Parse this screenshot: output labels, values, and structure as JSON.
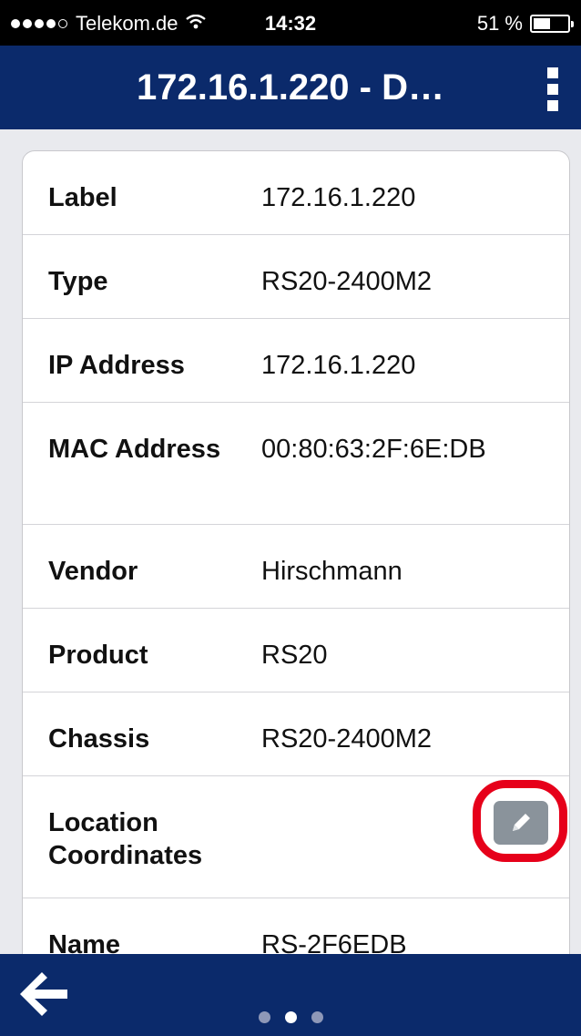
{
  "status_bar": {
    "carrier": "Telekom.de",
    "time": "14:32",
    "battery": "51 %",
    "battery_level": 0.51,
    "signal_bars": 4
  },
  "header": {
    "title": "172.16.1.220 - D…"
  },
  "details": [
    {
      "label": "Label",
      "value": "172.16.1.220"
    },
    {
      "label": "Type",
      "value": "RS20-2400M2"
    },
    {
      "label": "IP Address",
      "value": "172.16.1.220"
    },
    {
      "label": "MAC Address",
      "value": "00:80:63:2F:6E:DB"
    },
    {
      "label": "Vendor",
      "value": "Hirschmann"
    },
    {
      "label": "Product",
      "value": "RS20"
    },
    {
      "label": "Chassis",
      "value": "RS20-2400M2"
    },
    {
      "label": "Location Coordinates",
      "value": ""
    },
    {
      "label": "Name",
      "value": "RS-2F6EDB"
    }
  ],
  "footer": {
    "pages": 3,
    "active_page": 2
  },
  "colors": {
    "header_bg": "#0b2a6b",
    "highlight": "#e6001a",
    "edit_button": "#8a939b"
  },
  "icons": {
    "edit": "pencil-icon",
    "back": "arrow-left-icon",
    "menu": "more-vertical-icon"
  }
}
